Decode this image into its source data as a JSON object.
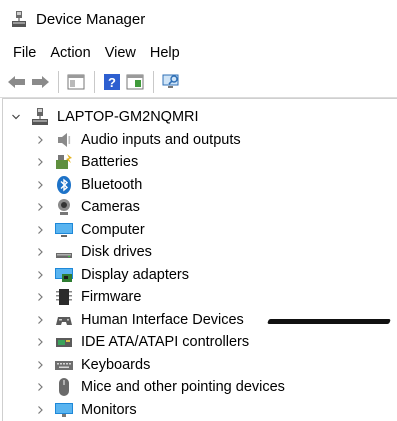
{
  "window": {
    "title": "Device Manager"
  },
  "menu": [
    "File",
    "Action",
    "View",
    "Help"
  ],
  "tree": {
    "root": "LAPTOP-GM2NQMRI",
    "items": [
      {
        "label": "Audio inputs and outputs",
        "icon": "speaker-icon"
      },
      {
        "label": "Batteries",
        "icon": "battery-icon"
      },
      {
        "label": "Bluetooth",
        "icon": "bluetooth-icon"
      },
      {
        "label": "Cameras",
        "icon": "camera-icon"
      },
      {
        "label": "Computer",
        "icon": "computer-icon"
      },
      {
        "label": "Disk drives",
        "icon": "disk-drive-icon"
      },
      {
        "label": "Display adapters",
        "icon": "display-adapter-icon"
      },
      {
        "label": "Firmware",
        "icon": "firmware-icon"
      },
      {
        "label": "Human Interface Devices",
        "icon": "hid-icon"
      },
      {
        "label": "IDE ATA/ATAPI controllers",
        "icon": "ide-controller-icon"
      },
      {
        "label": "Keyboards",
        "icon": "keyboard-icon"
      },
      {
        "label": "Mice and other pointing devices",
        "icon": "mouse-icon"
      },
      {
        "label": "Monitors",
        "icon": "monitor-icon"
      }
    ]
  },
  "colors": {
    "accent": "#1e73c8",
    "chevron": "#7a7a7a"
  }
}
